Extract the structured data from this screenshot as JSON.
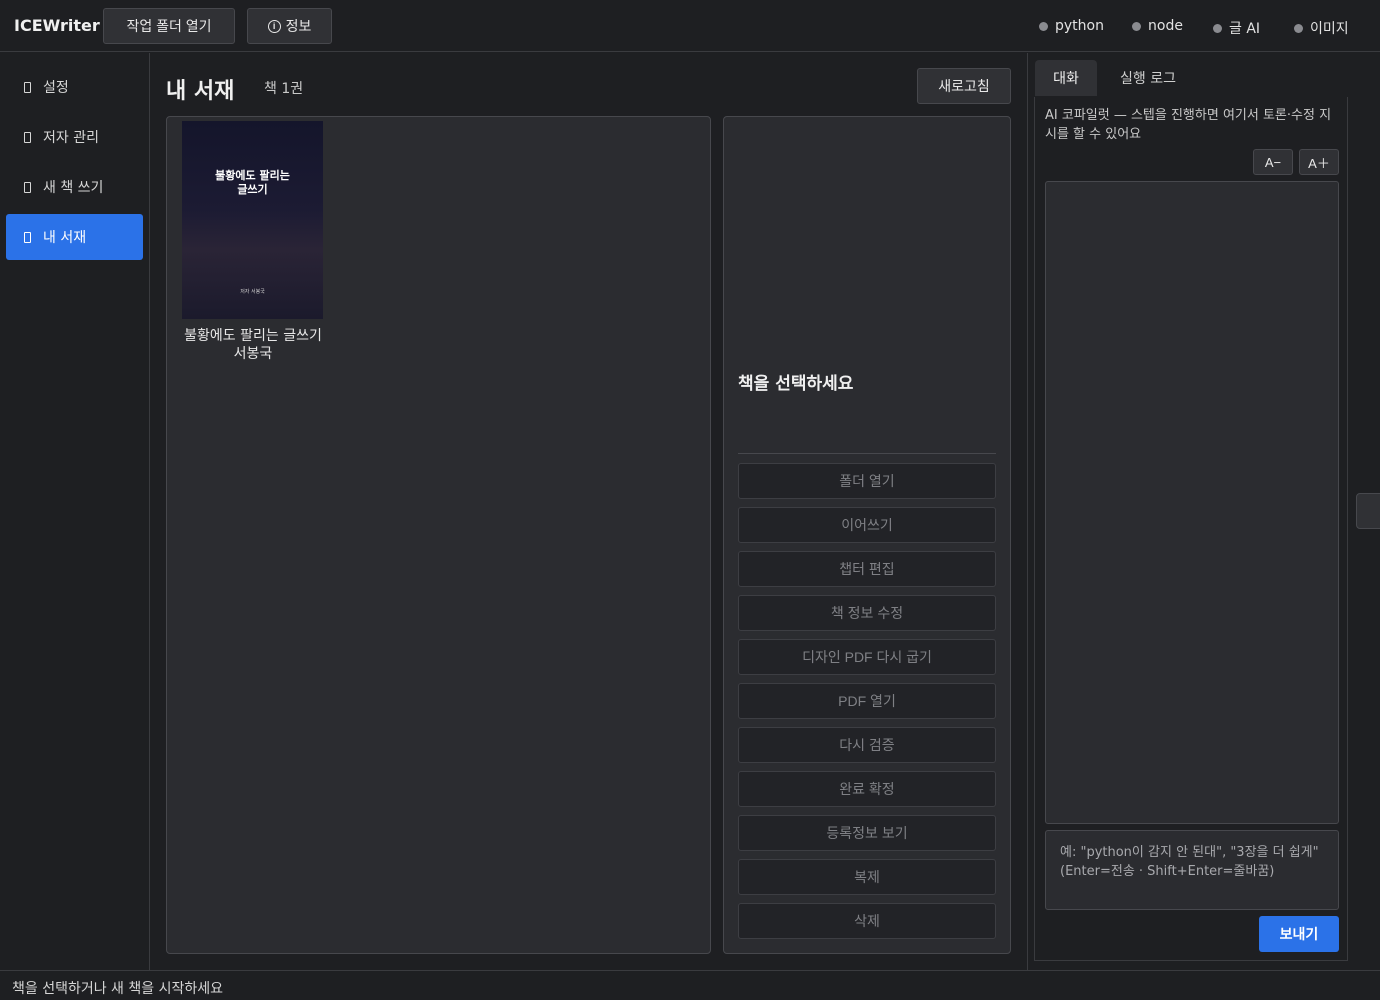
{
  "app": {
    "title": "ICEWriter",
    "open_folder_label": "작업 폴더 열기",
    "info_label": "정보"
  },
  "status_indicators": [
    {
      "label": "python",
      "color": "#8a8b90"
    },
    {
      "label": "node",
      "color": "#8a8b90"
    },
    {
      "label": "글 AI",
      "color": "#8a8b90"
    },
    {
      "label": "이미지",
      "color": "#8a8b90"
    }
  ],
  "sidebar": {
    "items": [
      {
        "label": "설정",
        "icon": "settings-icon",
        "active": false
      },
      {
        "label": "저자 관리",
        "icon": "authors-icon",
        "active": false
      },
      {
        "label": "새 책 쓰기",
        "icon": "new-book-icon",
        "active": false
      },
      {
        "label": "내 서재",
        "icon": "library-icon",
        "active": true
      }
    ]
  },
  "library": {
    "title": "내 서재",
    "count": "책 1권",
    "refresh_label": "새로고침",
    "books": [
      {
        "cover_title": "불황에도 팔리는\n글쓰기",
        "cover_author": "저자 서봉국",
        "title": "불황에도 팔리는 글쓰기",
        "author": "서봉국"
      }
    ]
  },
  "detail": {
    "placeholder": "책을 선택하세요",
    "actions": [
      "폴더 열기",
      "이어쓰기",
      "챕터 편집",
      "책 정보 수정",
      "디자인 PDF 다시 굽기",
      "PDF 열기",
      "다시 검증",
      "완료 확정",
      "등록정보 보기",
      "복제",
      "삭제"
    ]
  },
  "right_panel": {
    "tabs": [
      {
        "label": "대화",
        "active": true
      },
      {
        "label": "실행 로그",
        "active": false
      }
    ],
    "description": "AI 코파일럿 — 스텝을 진행하면 여기서 토론·수정 지시를 할 수 있어요",
    "font_smaller_label": "A−",
    "font_larger_label": "A＋",
    "input_placeholder": "예: \"python이 감지 안 된대\", \"3장을 더 쉽게\" (Enter=전송 · Shift+Enter=줄바꿈)",
    "send_label": "보내기"
  },
  "statusbar": {
    "text": "책을 선택하거나 새 책을 시작하세요"
  },
  "colors": {
    "accent": "#2b72e8",
    "background": "#1e1f22",
    "panel": "#2b2c30"
  }
}
